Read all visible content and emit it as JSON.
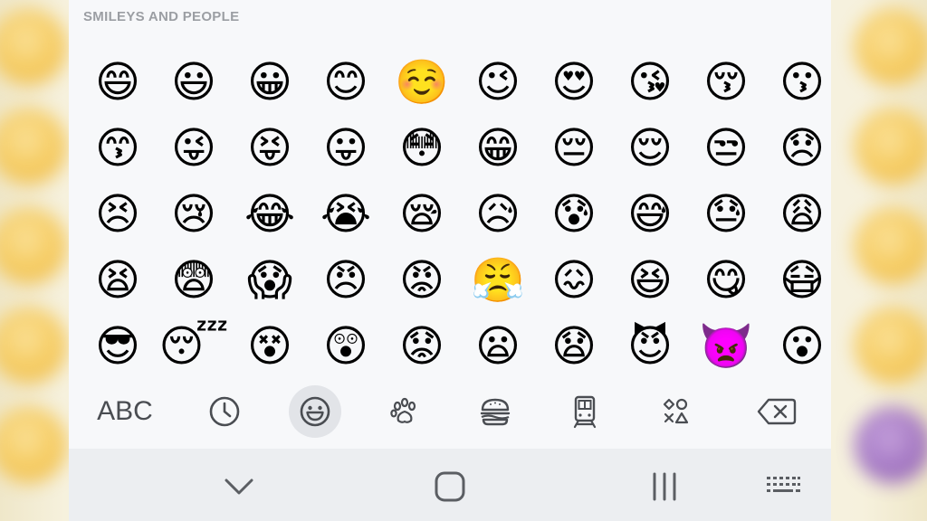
{
  "section": {
    "title": "SMILEYS AND PEOPLE"
  },
  "emoji_rows": [
    [
      "😄",
      "😃",
      "😀",
      "😊",
      "☺️",
      "😉",
      "😍",
      "😘",
      "😚",
      "😗"
    ],
    [
      "😙",
      "😜",
      "😝",
      "😛",
      "😳",
      "😁",
      "😔",
      "😌",
      "😒",
      "😞"
    ],
    [
      "😣",
      "😢",
      "😂",
      "😭",
      "😪",
      "😥",
      "😰",
      "😅",
      "😓",
      "😩"
    ],
    [
      "😫",
      "😨",
      "😱",
      "😠",
      "😡",
      "😤",
      "😖",
      "😆",
      "😋",
      "😷"
    ],
    [
      "😎",
      "😴",
      "😵",
      "😲",
      "😟",
      "😦",
      "😧",
      "😈",
      "👿",
      "😮"
    ]
  ],
  "toolbar": {
    "abc_label": "ABC",
    "categories": [
      {
        "icon": "clock-icon"
      },
      {
        "icon": "smiley-icon",
        "active": true
      },
      {
        "icon": "paw-icon"
      },
      {
        "icon": "burger-icon"
      },
      {
        "icon": "train-icon"
      },
      {
        "icon": "symbols-icon"
      },
      {
        "icon": "backspace-icon"
      }
    ]
  },
  "navbar": {
    "buttons": [
      "chevron-down-icon",
      "home-icon",
      "recents-icon",
      "keyboard-icon"
    ]
  },
  "colors": {
    "panel_bg": "#f7f8fa",
    "active_bg": "#e2e4e8",
    "icon": "#4a4d52",
    "section_title": "#9b9ea3"
  }
}
